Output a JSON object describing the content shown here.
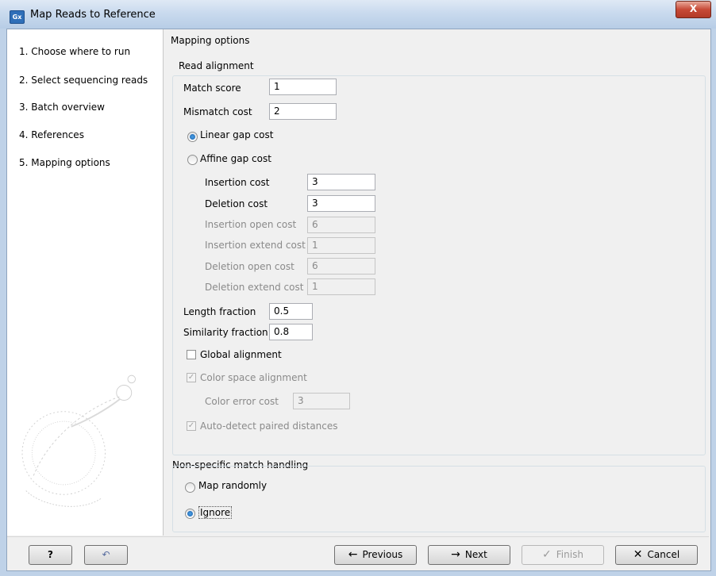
{
  "window": {
    "title": "Map Reads to Reference",
    "app_icon_text": "Gx",
    "close_label": "X"
  },
  "steps": [
    {
      "label": "1.  Choose where to run"
    },
    {
      "label": "2.  Select sequencing reads"
    },
    {
      "label": "3.  Batch overview"
    },
    {
      "label": "4.  References"
    },
    {
      "label": "5.  Mapping options"
    }
  ],
  "main": {
    "heading": "Mapping options",
    "read_alignment": {
      "title": "Read alignment",
      "match_score_label": "Match score",
      "match_score_value": "1",
      "mismatch_cost_label": "Mismatch cost",
      "mismatch_cost_value": "2",
      "linear_gap_label": "Linear gap cost",
      "linear_gap_selected": true,
      "affine_gap_label": "Affine gap cost",
      "affine_gap_selected": false,
      "insertion_cost_label": "Insertion cost",
      "insertion_cost_value": "3",
      "deletion_cost_label": "Deletion cost",
      "deletion_cost_value": "3",
      "insertion_open_label": "Insertion open cost",
      "insertion_open_value": "6",
      "insertion_extend_label": "Insertion extend cost",
      "insertion_extend_value": "1",
      "deletion_open_label": "Deletion open cost",
      "deletion_open_value": "6",
      "deletion_extend_label": "Deletion extend cost",
      "deletion_extend_value": "1",
      "length_fraction_label": "Length fraction",
      "length_fraction_value": "0.5",
      "similarity_fraction_label": "Similarity fraction",
      "similarity_fraction_value": "0.8",
      "global_alignment_label": "Global alignment",
      "global_alignment_checked": false,
      "color_space_label": "Color space alignment",
      "color_space_checked": true,
      "color_error_label": "Color error cost",
      "color_error_value": "3",
      "auto_detect_label": "Auto-detect paired distances",
      "auto_detect_checked": true
    },
    "nonspecific": {
      "title": "Non-specific match handling",
      "map_randomly_label": "Map randomly",
      "map_randomly_selected": false,
      "ignore_label": "Ignore",
      "ignore_selected": true
    }
  },
  "buttons": {
    "help": "?",
    "previous": "Previous",
    "next": "Next",
    "finish": "Finish",
    "cancel": "Cancel"
  }
}
